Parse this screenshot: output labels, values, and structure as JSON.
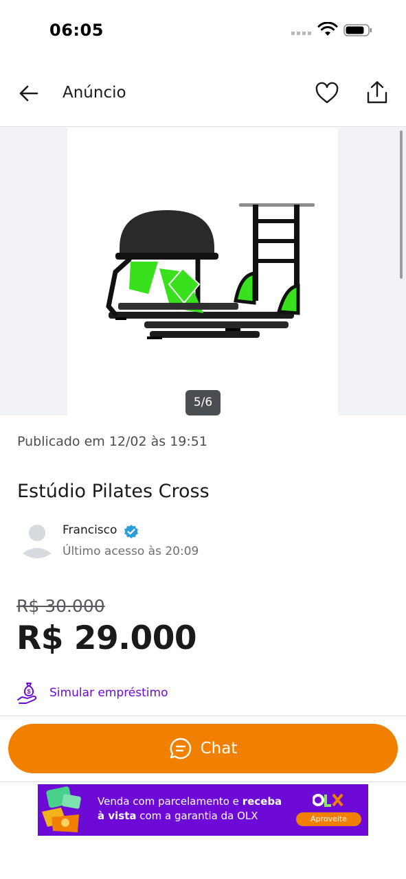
{
  "status_bar": {
    "time": "06:05"
  },
  "header": {
    "title": "Anúncio"
  },
  "gallery": {
    "counter": "5/6"
  },
  "listing": {
    "published": "Publicado em 12/02 às 19:51",
    "title": "Estúdio Pilates Cross",
    "old_price": "R$ 30.000",
    "price": "R$ 29.000"
  },
  "seller": {
    "name": "Francisco",
    "last_seen": "Último acesso às 20:09"
  },
  "loan": {
    "label": "Simular empréstimo"
  },
  "chat": {
    "label": "Chat"
  },
  "banner": {
    "text_plain_1": "Venda com parcelamento e ",
    "text_bold_1": "receba",
    "text_bold_2": "à vista",
    "text_plain_2": " com a garantia da OLX",
    "brand": "OLX",
    "cta": "Aproveite"
  },
  "colors": {
    "accent_orange": "#f28000",
    "olx_purple": "#6e0ad6",
    "verified_blue": "#2d9cdb",
    "equipment_green": "#39e01d"
  },
  "icons": [
    "back-arrow-icon",
    "heart-icon",
    "share-icon",
    "verified-icon",
    "loan-icon",
    "chat-bubble-icon",
    "wifi-icon",
    "battery-icon"
  ]
}
